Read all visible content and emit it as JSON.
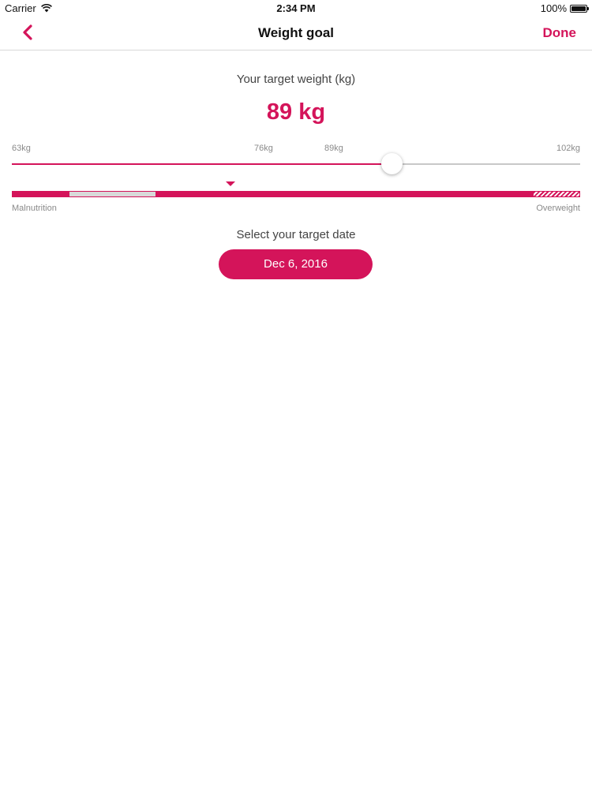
{
  "status_bar": {
    "carrier": "Carrier",
    "time": "2:34 PM",
    "battery": "100%"
  },
  "nav": {
    "title": "Weight goal",
    "done_label": "Done"
  },
  "target": {
    "label": "Your target weight (kg)",
    "value": "89 kg"
  },
  "slider": {
    "ticks": [
      "63kg",
      "76kg",
      "89kg",
      "102kg"
    ],
    "min_kg": 63,
    "max_kg": 102,
    "current_kg": 89
  },
  "bmi_scale": {
    "left_label": "Malnutrition",
    "right_label": "Overweight"
  },
  "date": {
    "label": "Select your target date",
    "value": "Dec 6, 2016"
  },
  "colors": {
    "accent": "#d4145a",
    "track": "#c8c8c8",
    "muted_text": "#8a8a8a"
  }
}
